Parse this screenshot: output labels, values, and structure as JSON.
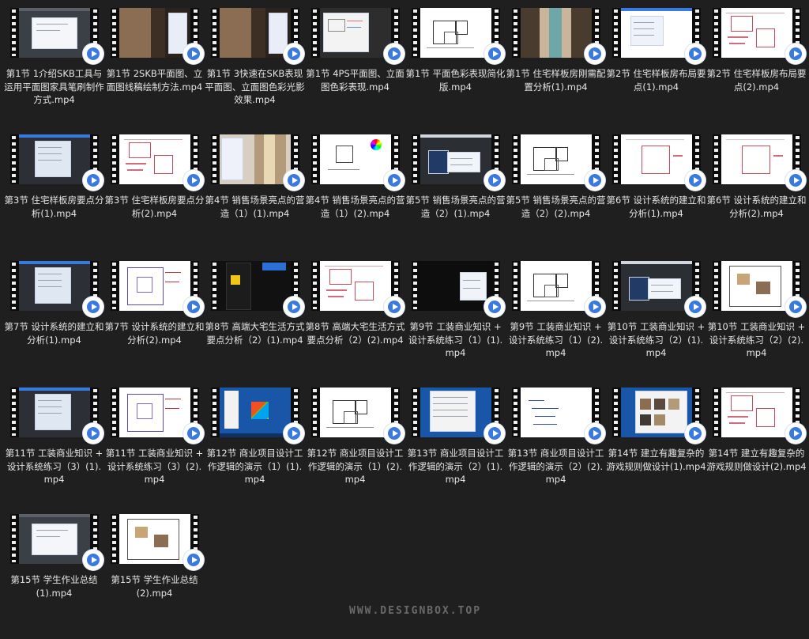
{
  "window": {
    "background": "#1f1f1f",
    "accent": "#3a79e0"
  },
  "files": [
    {
      "name": "第1节 1介绍SKB工具与运用平面图家具笔刷制作方式.mp4",
      "scene": "dialog"
    },
    {
      "name": "第1节 2SKB平面图、立面图线稿绘制方法.mp4",
      "scene": "photo-panel"
    },
    {
      "name": "第1节 3快速在SKB表现平面图、立面图色彩光影效果.mp4",
      "scene": "photo-panel"
    },
    {
      "name": "第1节 4PS平面图、立面图色彩表现.mp4",
      "scene": "ps-window"
    },
    {
      "name": "第1节 平面色彩表现简化版.mp4",
      "scene": "plan-white"
    },
    {
      "name": "第1节 住宅样板房刚需配置分析(1).mp4",
      "scene": "corridor"
    },
    {
      "name": "第2节 住宅样板房布局要点(1).mp4",
      "scene": "menu-white"
    },
    {
      "name": "第2节 住宅样板房布局要点(2).mp4",
      "scene": "red-sketch"
    },
    {
      "name": "第3节 住宅样板房要点分析(1).mp4",
      "scene": "dark-ui"
    },
    {
      "name": "第3节 住宅样板房要点分析(2).mp4",
      "scene": "red-sketch"
    },
    {
      "name": "第4节 销售场景亮点的营造（1）(1).mp4",
      "scene": "corridor-panel"
    },
    {
      "name": "第4节 销售场景亮点的营造（1）(2).mp4",
      "scene": "color-wheel"
    },
    {
      "name": "第5节 销售场景亮点的营造（2）(1).mp4",
      "scene": "menu-dark"
    },
    {
      "name": "第5节 销售场景亮点的营造（2）(2).mp4",
      "scene": "plan-white"
    },
    {
      "name": "第6节 设计系统的建立和分析(1).mp4",
      "scene": "red-box"
    },
    {
      "name": "第6节 设计系统的建立和分析(2).mp4",
      "scene": "red-box"
    },
    {
      "name": "第7节 设计系统的建立和分析(1).mp4",
      "scene": "dark-ui"
    },
    {
      "name": "第7节 设计系统的建立和分析(2).mp4",
      "scene": "plan-purple"
    },
    {
      "name": "第8节 高端大宅生活方式要点分析（2）(1).mp4",
      "scene": "phone-dark"
    },
    {
      "name": "第8节 高端大宅生活方式要点分析（2）(2).mp4",
      "scene": "red-sketch"
    },
    {
      "name": "第9节 工装商业知识 + 设计系统练习（1）(1).mp4",
      "scene": "black-panel"
    },
    {
      "name": "第9节 工装商业知识 + 设计系统练习（1）(2).mp4",
      "scene": "plan-white"
    },
    {
      "name": "第10节 工装商业知识 + 设计系统练习（2）(1).mp4",
      "scene": "menu-dark"
    },
    {
      "name": "第10节 工装商业知识 + 设计系统练习（2）(2).mp4",
      "scene": "plan-color"
    },
    {
      "name": "第11节 工装商业知识 + 设计系统练习（3）(1).mp4",
      "scene": "dark-ui"
    },
    {
      "name": "第11节 工装商业知识 + 设计系统练习（3）(2).mp4",
      "scene": "plan-purple"
    },
    {
      "name": "第12节 商业项目设计工作逻辑的演示（1）(1).mp4",
      "scene": "win7"
    },
    {
      "name": "第12节 商业项目设计工作逻辑的演示（1）(2).mp4",
      "scene": "plan-white"
    },
    {
      "name": "第13节 商业项目设计工作逻辑的演示（2）(1).mp4",
      "scene": "win7-explorer"
    },
    {
      "name": "第13节 商业项目设计工作逻辑的演示（2）(2).mp4",
      "scene": "handwriting"
    },
    {
      "name": "第14节 建立有趣复杂的游戏规则做设计(1).mp4",
      "scene": "win7-gallery"
    },
    {
      "name": "第14节 建立有趣复杂的游戏规则做设计(2).mp4",
      "scene": "red-sketch"
    },
    {
      "name": "第15节 学生作业总结(1).mp4",
      "scene": "dialog"
    },
    {
      "name": "第15节 学生作业总结(2).mp4",
      "scene": "plan-color"
    }
  ],
  "watermark": "WWW.DESIGNBOX.TOP",
  "scenes": {
    "dialog": {
      "bg": "#3b3f46",
      "panel": "#f4f6fa"
    },
    "photo-panel": {
      "bg": "#2a221c",
      "photo": "#8a6d52",
      "panel": "#e8edf6"
    },
    "ps-window": {
      "bg": "#2d2d2d",
      "panel": "#f3f3f3"
    },
    "plan-white": {
      "bg": "#ffffff"
    },
    "corridor": {
      "bg": "#4a3b2f",
      "photo": "#c9b59c"
    },
    "menu-white": {
      "bg": "#ffffff",
      "panel": "#eef3fb"
    },
    "red-sketch": {
      "bg": "#ffffff"
    },
    "dark-ui": {
      "bg": "#2c2f35",
      "panel": "#dfe7f3"
    },
    "corridor-panel": {
      "bg": "#d8cfc2",
      "photo": "#b39a7a",
      "panel": "#eef2f8"
    },
    "color-wheel": {
      "bg": "#ffffff"
    },
    "menu-dark": {
      "bg": "#2b2e33",
      "panel": "#f1f4f9"
    },
    "red-box": {
      "bg": "#ffffff"
    },
    "plan-purple": {
      "bg": "#ffffff"
    },
    "phone-dark": {
      "bg": "#111111"
    },
    "black-panel": {
      "bg": "#0d0d0d",
      "panel": "#f0f3f8"
    },
    "plan-color": {
      "bg": "#ffffff"
    },
    "win7": {
      "bg": "#1a56a8"
    },
    "win7-explorer": {
      "bg": "#1a56a8",
      "panel": "#f3f3f3"
    },
    "handwriting": {
      "bg": "#ffffff"
    },
    "win7-gallery": {
      "bg": "#1a56a8",
      "panel": "#f3f3f3"
    }
  }
}
